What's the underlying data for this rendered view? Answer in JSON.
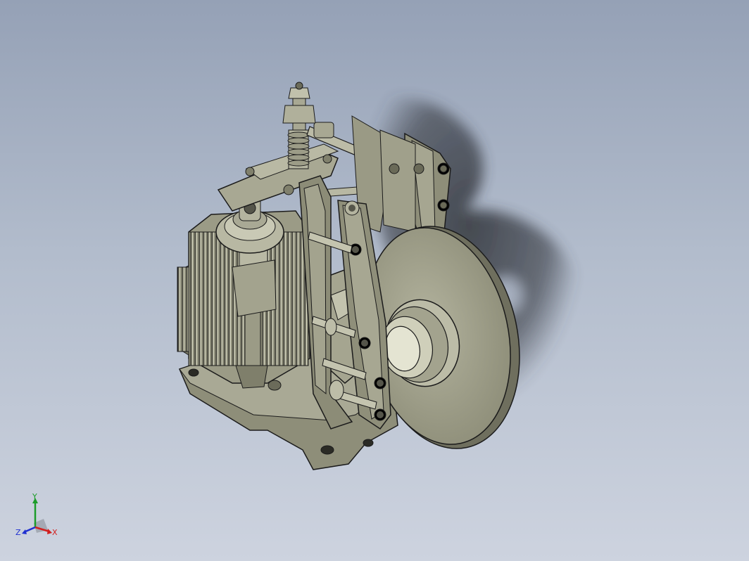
{
  "viewport": {
    "background_top": "#95a1b6",
    "background_bottom": "#cdd3df",
    "model_color": "#9a9a87",
    "edge_color": "#1b1b1b"
  },
  "triad": {
    "x_label": "X",
    "y_label": "Y",
    "z_label": "Z",
    "x_color": "#d22020",
    "y_color": "#1c9c2a",
    "z_color": "#2030d0"
  }
}
